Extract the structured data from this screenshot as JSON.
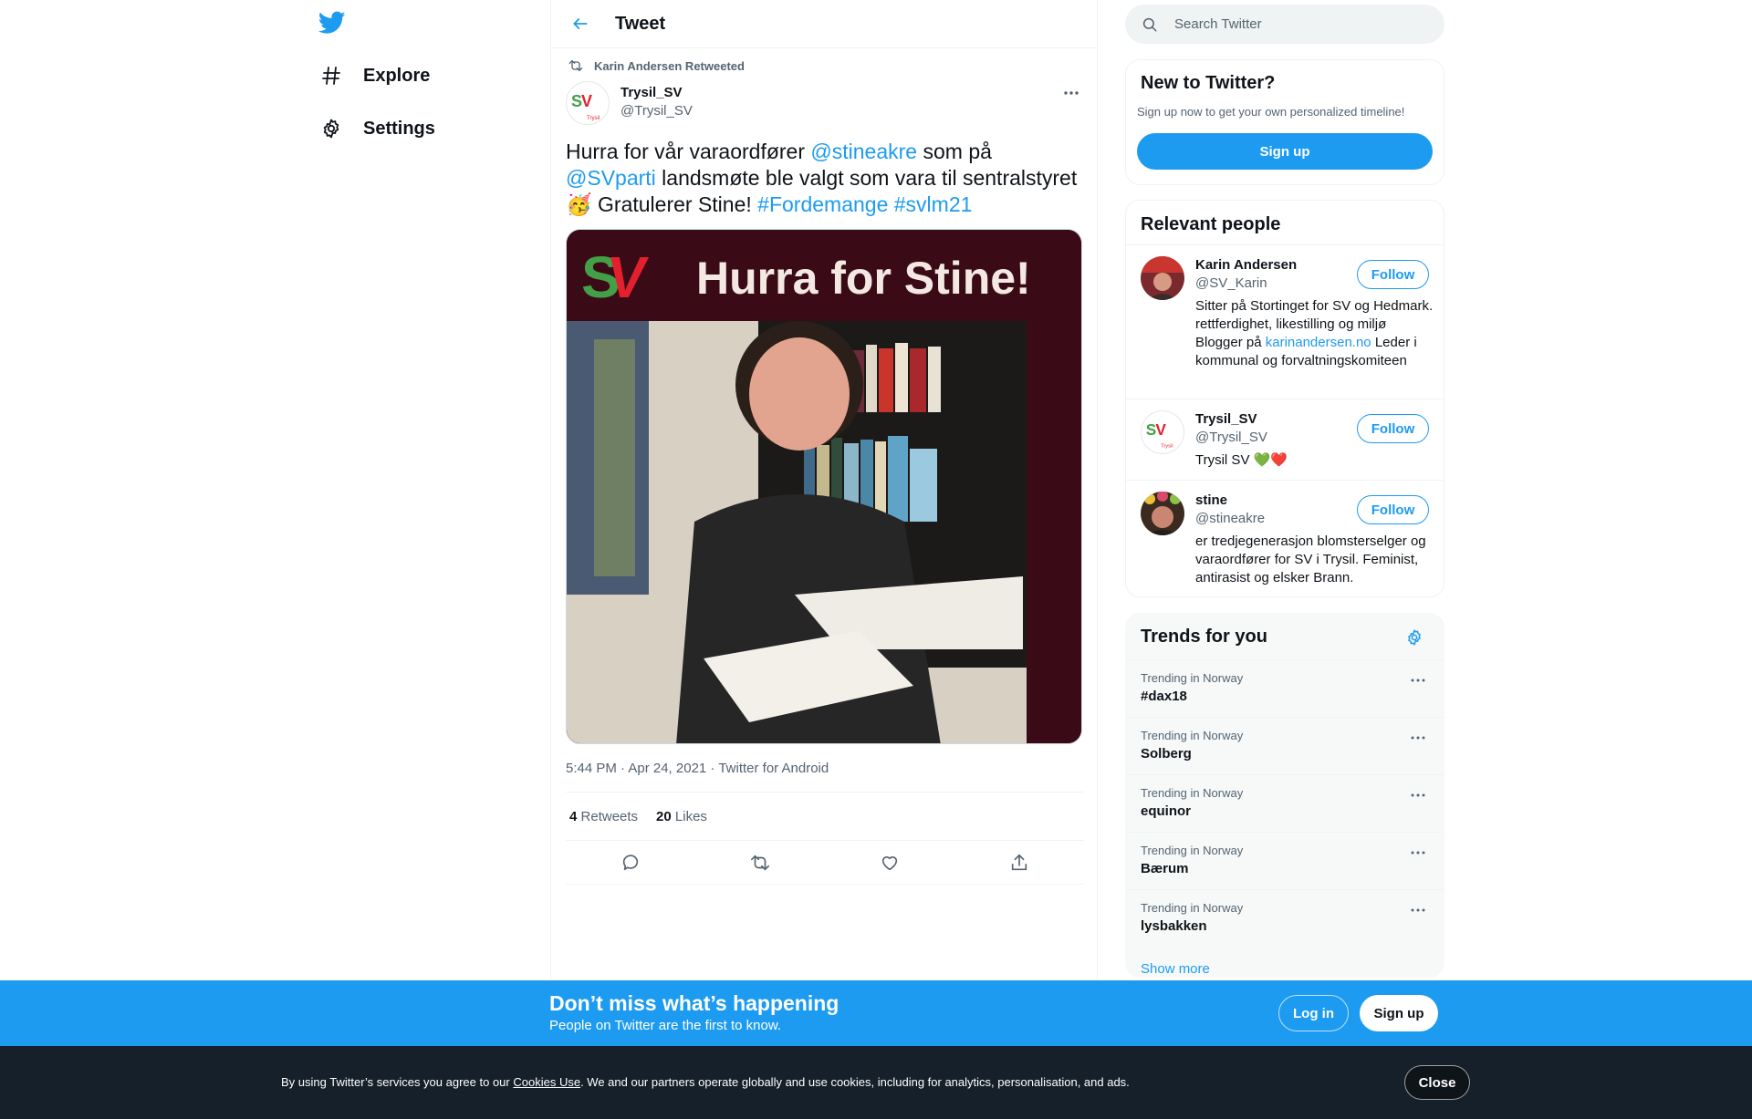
{
  "nav": {
    "logo_icon": "twitter-bird-icon",
    "items": [
      {
        "label": "Explore",
        "icon": "hashtag-icon"
      },
      {
        "label": "Settings",
        "icon": "gear-icon"
      }
    ]
  },
  "header": {
    "title": "Tweet",
    "back_icon": "arrow-left-icon"
  },
  "tweet": {
    "retweeted_by": "Karin Andersen Retweeted",
    "author_name": "Trysil_SV",
    "author_handle": "@Trysil_SV",
    "text": {
      "p1": "Hurra for vår varaordfører ",
      "m1": "@stineakre",
      "p2": " som på ",
      "m2": "@SVparti",
      "p3": " landsmøte ble valgt som vara til sentralstyret ",
      "emoji": "🥳",
      "p4": " Gratulerer Stine! ",
      "h1": "#Fordemange",
      "sp": " ",
      "h2": "#svlm21"
    },
    "image": {
      "logo_text": "SV",
      "headline": "Hurra for Stine!"
    },
    "meta": "5:44 PM · Apr 24, 2021 · Twitter for Android",
    "retweets_count": "4",
    "retweets_label": "Retweets",
    "likes_count": "20",
    "likes_label": "Likes"
  },
  "search": {
    "placeholder": "Search Twitter"
  },
  "new_to_twitter": {
    "title": "New to Twitter?",
    "subtitle": "Sign up now to get your own personalized timeline!",
    "button": "Sign up"
  },
  "relevant_people": {
    "title": "Relevant people",
    "follow_label": "Follow",
    "people": [
      {
        "name": "Karin Andersen",
        "handle": "@SV_Karin",
        "bio_before": "Sitter på Stortinget for SV og Hedmark. rettferdighet, likestilling og miljø Blogger på ",
        "bio_link": "karinandersen.no",
        "bio_after": " Leder i kommunal og forvaltningskomiteen"
      },
      {
        "name": "Trysil_SV",
        "handle": "@Trysil_SV",
        "bio": "Trysil SV 💚❤️"
      },
      {
        "name": "stine",
        "handle": "@stineakre",
        "bio": "er tredjegenerasjon blomsterselger og varaordfører for SV i Trysil. Feminist, antirasist og elsker Brann."
      }
    ]
  },
  "trends": {
    "title": "Trends for you",
    "items": [
      {
        "context": "Trending in Norway",
        "name": "#dax18"
      },
      {
        "context": "Trending in Norway",
        "name": "Solberg"
      },
      {
        "context": "Trending in Norway",
        "name": "equinor"
      },
      {
        "context": "Trending in Norway",
        "name": "Bærum"
      },
      {
        "context": "Trending in Norway",
        "name": "lysbakken"
      }
    ],
    "show_more": "Show more"
  },
  "banner": {
    "title": "Don’t miss what’s happening",
    "subtitle": "People on Twitter are the first to know.",
    "login": "Log in",
    "signup": "Sign up"
  },
  "cookie": {
    "before": "By using Twitter’s services you agree to our ",
    "link": "Cookies Use",
    "after": ". We and our partners operate globally and use cookies, including for analytics, personalisation, and ads.",
    "close": "Close"
  },
  "colors": {
    "accent": "#1d9bf0",
    "text": "#0f1419",
    "secondary": "#536471",
    "sv_red": "#e4202e",
    "sv_green": "#43a047",
    "image_bg": "#3a0b17"
  }
}
